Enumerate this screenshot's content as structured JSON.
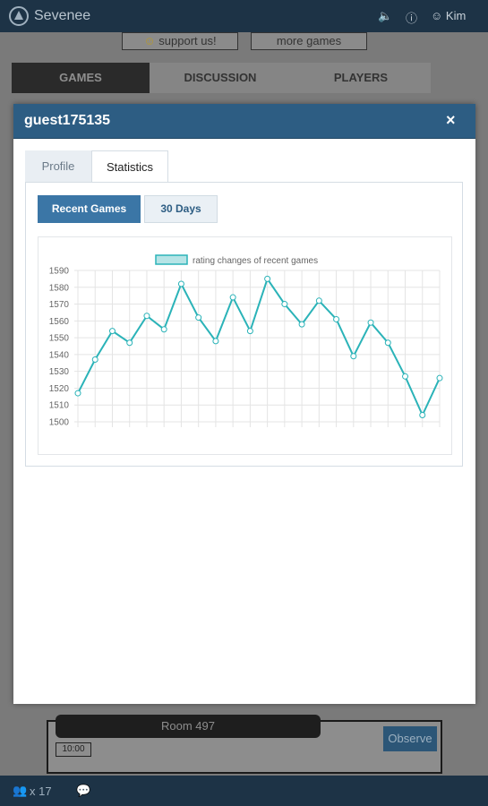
{
  "app": {
    "brand": "Sevenee",
    "user": "Kim",
    "support_label": "support us!",
    "more_games_label": "more games"
  },
  "tabs": [
    "GAMES",
    "DISCUSSION",
    "PLAYERS"
  ],
  "room": {
    "title": "Room 497",
    "timer": "10:00",
    "observe_label": "Observe"
  },
  "footer": {
    "players_count": "x 17"
  },
  "modal": {
    "title": "guest175135",
    "close_symbol": "×",
    "tabs": [
      "Profile",
      "Statistics"
    ],
    "active_tab": "Statistics",
    "buttons": [
      "Recent Games",
      "30 Days"
    ]
  },
  "colors": {
    "accent": "#2d5d83",
    "line": "#2bb3b8",
    "legend_fill": "#b6e4e6"
  },
  "chart_data": {
    "type": "line",
    "legend": "rating changes of recent games",
    "ylim": [
      1500,
      1590
    ],
    "yticks": [
      1590,
      1580,
      1570,
      1560,
      1550,
      1540,
      1530,
      1520,
      1510,
      1500
    ],
    "grid": true,
    "legend_position": "top",
    "series": [
      {
        "name": "rating changes of recent games",
        "values": [
          1517,
          1537,
          1554,
          1547,
          1563,
          1555,
          1582,
          1562,
          1548,
          1574,
          1554,
          1585,
          1570,
          1558,
          1572,
          1561,
          1539,
          1559,
          1547,
          1527,
          1504,
          1526
        ]
      }
    ]
  }
}
